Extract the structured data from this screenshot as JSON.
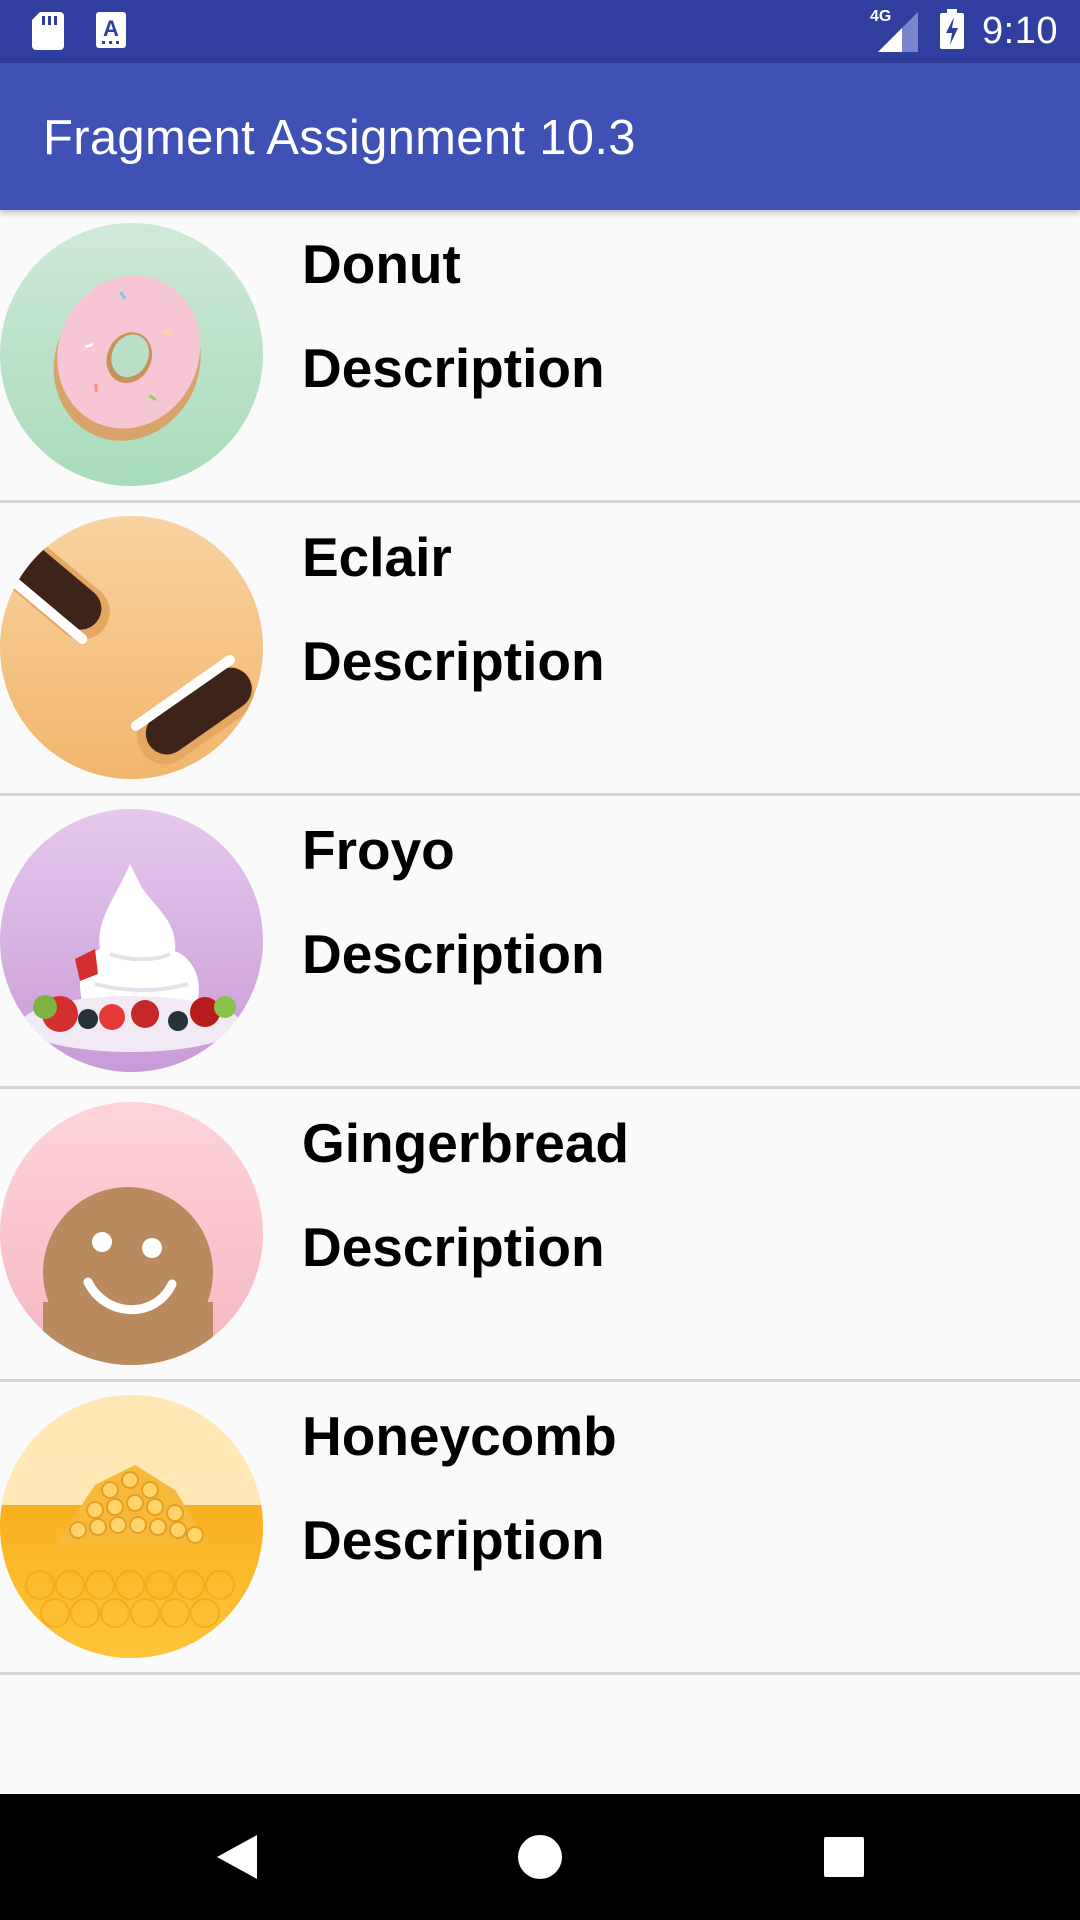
{
  "status_bar": {
    "time": "9:10",
    "network": "4G",
    "icons": [
      "sd-card-icon",
      "keyboard-a-icon",
      "signal-4g-icon",
      "battery-charging-icon"
    ]
  },
  "app_bar": {
    "title": "Fragment Assignment 10.3",
    "color": "#3f51b5",
    "status_color": "#303f9f"
  },
  "items": [
    {
      "title": "Donut",
      "description": "Description",
      "image": "donut-image"
    },
    {
      "title": "Eclair",
      "description": "Description",
      "image": "eclair-image"
    },
    {
      "title": "Froyo",
      "description": "Description",
      "image": "froyo-image"
    },
    {
      "title": "Gingerbread",
      "description": "Description",
      "image": "gingerbread-image"
    },
    {
      "title": "Honeycomb",
      "description": "Description",
      "image": "honeycomb-image"
    }
  ],
  "nav_bar": {
    "buttons": [
      "back-icon",
      "home-icon",
      "recents-icon"
    ]
  }
}
